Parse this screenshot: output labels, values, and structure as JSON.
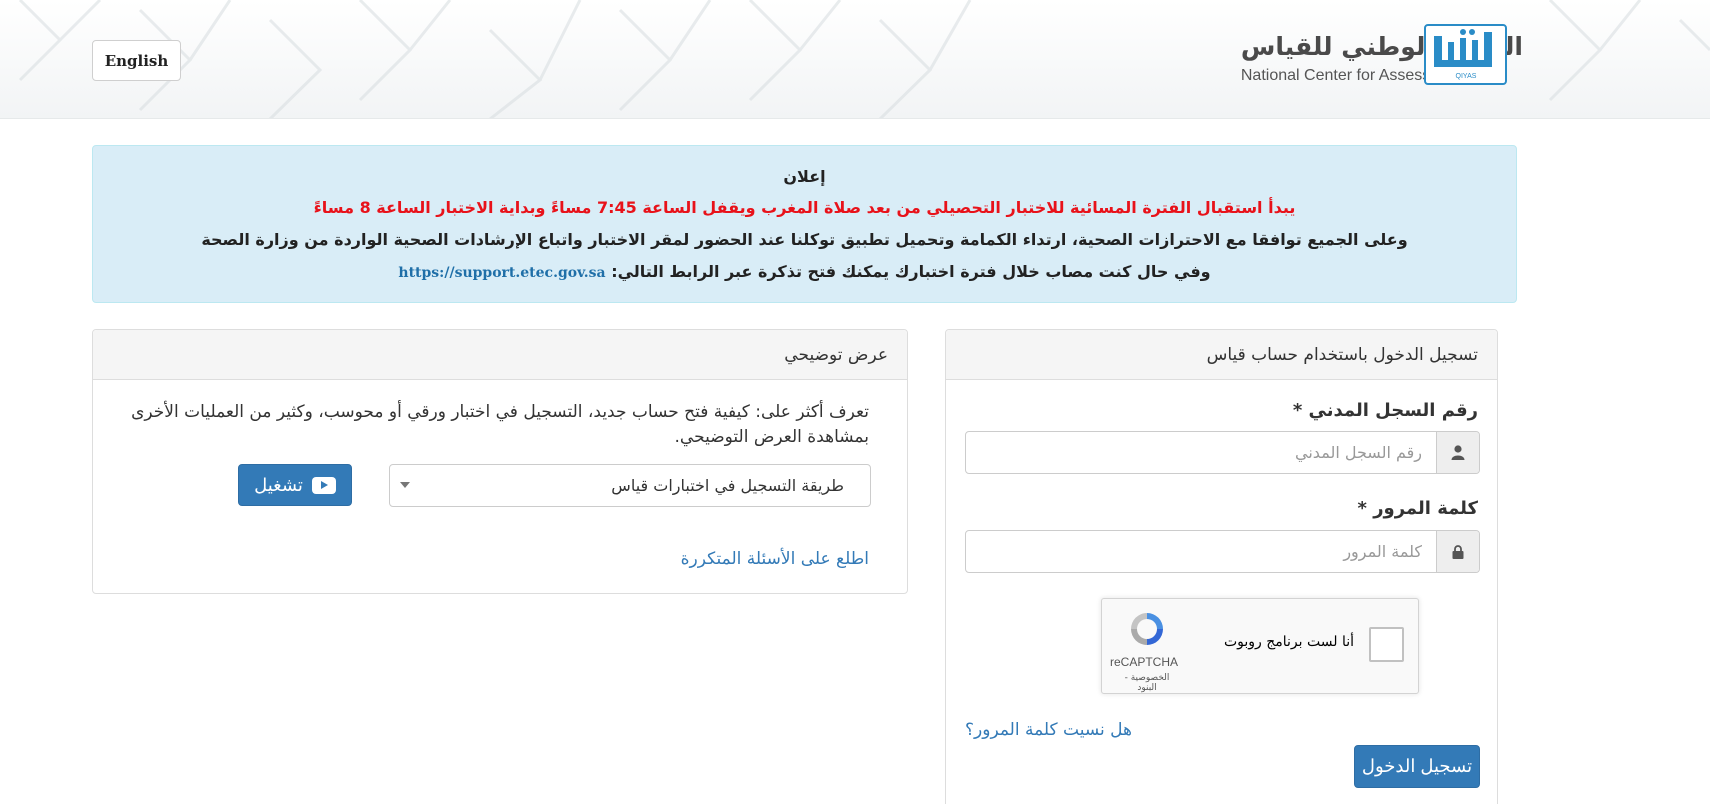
{
  "header": {
    "language_button": "English",
    "brand_name_ar": "المركز الوطني للقياس",
    "brand_name_en": "National Center for Assessment",
    "logo_label": "QIYAS",
    "accent_color": "#2a8cc7"
  },
  "announcement": {
    "title": "إعلان",
    "highlight": "يبدأ استقبال الفترة المسائية للاختبار التحصيلي من بعد صلاة المغرب ويقفل الساعة 7:45 مساءً وبداية الاختبار الساعة 8 مساءً",
    "line2": "وعلى الجميع توافقا مع الاحترازات الصحية، ارتداء الكمامة وتحميل تطبيق توكلنا عند الحضور لمقر الاختبار واتباع الإرشادات الصحية الواردة من وزارة الصحة",
    "line3": "وفي حال كنت مصاب خلال فترة اختبارك يمكنك فتح تذكرة عبر الرابط التالي:",
    "link": "https://support.etec.gov.sa",
    "highlight_color": "#e8121a",
    "background_color": "#d9edf7"
  },
  "demo": {
    "title": "عرض توضيحي",
    "description": "تعرف أكثر على: كيفية فتح حساب جديد، التسجيل في اختبار ورقي أو محوسب، وكثير من العمليات الأخرى بمشاهدة العرض التوضيحي.",
    "select_value": "طريقة التسجيل في اختبارات قياس",
    "play_button": "تشغيل",
    "faq_link": "اطلع على الأسئلة المتكررة"
  },
  "login": {
    "title": "تسجيل الدخول باستخدام حساب قياس",
    "id_label": "رقم السجل المدني",
    "id_placeholder": "رقم السجل المدني",
    "password_label": "كلمة المرور",
    "password_placeholder": "كلمة المرور",
    "required_mark": "*",
    "captcha_text": "أنا لست برنامج روبوت",
    "captcha_brand": "reCAPTCHA",
    "captcha_terms": "الخصوصية - البنود",
    "forgot_link": "هل نسيت كلمة المرور؟",
    "submit_button": "تسجيل الدخول",
    "button_color": "#337ab7"
  }
}
